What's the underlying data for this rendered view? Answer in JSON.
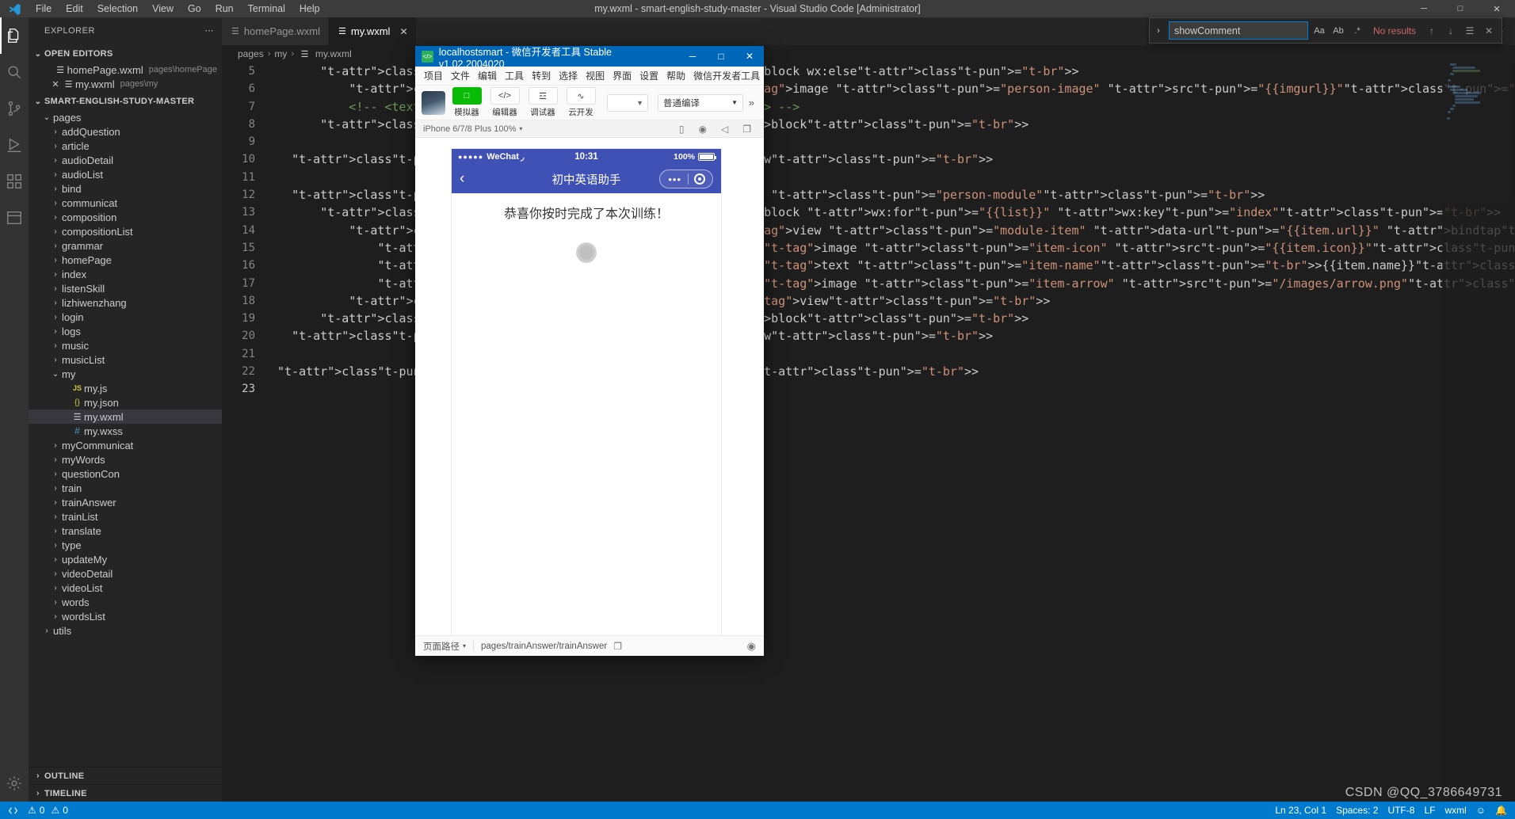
{
  "window": {
    "title": "my.wxml - smart-english-study-master - Visual Studio Code [Administrator]",
    "menus": [
      "File",
      "Edit",
      "Selection",
      "View",
      "Go",
      "Run",
      "Terminal",
      "Help"
    ],
    "controls": {
      "minimize": "─",
      "maximize": "□",
      "close": "✕"
    }
  },
  "activitybar": {
    "items": [
      {
        "name": "explorer",
        "glyph": "❐"
      },
      {
        "name": "search",
        "glyph": "⌕"
      },
      {
        "name": "source-control",
        "glyph": "⎇"
      },
      {
        "name": "run-debug",
        "glyph": "▷"
      },
      {
        "name": "extensions",
        "glyph": "▦"
      },
      {
        "name": "test",
        "glyph": "▤"
      }
    ],
    "settings_glyph": "⚙"
  },
  "sidebar": {
    "header": "EXPLORER",
    "header_more": "⋯",
    "open_editors": {
      "title": "OPEN EDITORS",
      "chevron": "⌄",
      "items": [
        {
          "name": "homePage.wxml",
          "path": "pages\\homePage",
          "icon": "wxml-icon",
          "closable": false
        },
        {
          "name": "my.wxml",
          "path": "pages\\my",
          "icon": "wxml-icon",
          "closable": true
        }
      ]
    },
    "project": {
      "title": "SMART-ENGLISH-STUDY-MASTER",
      "chevron": "⌄"
    },
    "tree": [
      {
        "label": "pages",
        "indent": 1,
        "type": "folder",
        "open": true
      },
      {
        "label": "addQuestion",
        "indent": 2,
        "type": "folder",
        "open": false
      },
      {
        "label": "article",
        "indent": 2,
        "type": "folder",
        "open": false
      },
      {
        "label": "audioDetail",
        "indent": 2,
        "type": "folder",
        "open": false
      },
      {
        "label": "audioList",
        "indent": 2,
        "type": "folder",
        "open": false
      },
      {
        "label": "bind",
        "indent": 2,
        "type": "folder",
        "open": false
      },
      {
        "label": "communicat",
        "indent": 2,
        "type": "folder",
        "open": false
      },
      {
        "label": "composition",
        "indent": 2,
        "type": "folder",
        "open": false
      },
      {
        "label": "compositionList",
        "indent": 2,
        "type": "folder",
        "open": false
      },
      {
        "label": "grammar",
        "indent": 2,
        "type": "folder",
        "open": false
      },
      {
        "label": "homePage",
        "indent": 2,
        "type": "folder",
        "open": false
      },
      {
        "label": "index",
        "indent": 2,
        "type": "folder",
        "open": false
      },
      {
        "label": "listenSkill",
        "indent": 2,
        "type": "folder",
        "open": false
      },
      {
        "label": "lizhiwenzhang",
        "indent": 2,
        "type": "folder",
        "open": false
      },
      {
        "label": "login",
        "indent": 2,
        "type": "folder",
        "open": false
      },
      {
        "label": "logs",
        "indent": 2,
        "type": "folder",
        "open": false
      },
      {
        "label": "music",
        "indent": 2,
        "type": "folder",
        "open": false
      },
      {
        "label": "musicList",
        "indent": 2,
        "type": "folder",
        "open": false
      },
      {
        "label": "my",
        "indent": 2,
        "type": "folder",
        "open": true
      },
      {
        "label": "my.js",
        "indent": 3,
        "type": "js"
      },
      {
        "label": "my.json",
        "indent": 3,
        "type": "json"
      },
      {
        "label": "my.wxml",
        "indent": 3,
        "type": "wxml",
        "selected": true
      },
      {
        "label": "my.wxss",
        "indent": 3,
        "type": "wxss"
      },
      {
        "label": "myCommunicat",
        "indent": 2,
        "type": "folder",
        "open": false
      },
      {
        "label": "myWords",
        "indent": 2,
        "type": "folder",
        "open": false
      },
      {
        "label": "questionCon",
        "indent": 2,
        "type": "folder",
        "open": false
      },
      {
        "label": "train",
        "indent": 2,
        "type": "folder",
        "open": false
      },
      {
        "label": "trainAnswer",
        "indent": 2,
        "type": "folder",
        "open": false
      },
      {
        "label": "trainList",
        "indent": 2,
        "type": "folder",
        "open": false
      },
      {
        "label": "translate",
        "indent": 2,
        "type": "folder",
        "open": false
      },
      {
        "label": "type",
        "indent": 2,
        "type": "folder",
        "open": false
      },
      {
        "label": "updateMy",
        "indent": 2,
        "type": "folder",
        "open": false
      },
      {
        "label": "videoDetail",
        "indent": 2,
        "type": "folder",
        "open": false
      },
      {
        "label": "videoList",
        "indent": 2,
        "type": "folder",
        "open": false
      },
      {
        "label": "words",
        "indent": 2,
        "type": "folder",
        "open": false
      },
      {
        "label": "wordsList",
        "indent": 2,
        "type": "folder",
        "open": false
      },
      {
        "label": "utils",
        "indent": 1,
        "type": "folder",
        "open": false
      }
    ],
    "footer_sections": [
      {
        "label": "OUTLINE",
        "chevron": "›"
      },
      {
        "label": "TIMELINE",
        "chevron": "›"
      }
    ]
  },
  "editor": {
    "tabs": [
      {
        "label": "homePage.wxml",
        "icon": "wxml-icon",
        "active": false,
        "closable": false
      },
      {
        "label": "my.wxml",
        "icon": "wxml-icon",
        "active": true,
        "closable": true,
        "close_glyph": "✕"
      }
    ],
    "tab_actions": [
      {
        "name": "split-editor-icon",
        "glyph": "◫"
      },
      {
        "name": "more-actions-icon",
        "glyph": "⋯"
      }
    ],
    "breadcrumbs": [
      "pages",
      "my",
      "my.wxml"
    ],
    "breadcrumb_sep": "›",
    "first_line_number": 5,
    "lines": [
      {
        "n": 5,
        "text": "      <block wx:else>"
      },
      {
        "n": 6,
        "text": "          <image class=\"person-image\" src=\"{{imgurl}}\"></image>"
      },
      {
        "n": 7,
        "text": "          <!-- <text class=\"person-name\">{{userInfo.nickName}}</text> -->"
      },
      {
        "n": 8,
        "text": "      </block>"
      },
      {
        "n": 9,
        "text": ""
      },
      {
        "n": 10,
        "text": "  </view>"
      },
      {
        "n": 11,
        "text": ""
      },
      {
        "n": 12,
        "text": "  <view class=\"person-module\">"
      },
      {
        "n": 13,
        "text": "      <block wx:for=\"{{list}}\" wx:key=\"index\">"
      },
      {
        "n": 14,
        "text": "          <view class=\"module-item\" data-url=\"{{item.url}}\" bindtap=\"jump\">"
      },
      {
        "n": 15,
        "text": "              <image class=\"item-icon\" src=\"{{item.icon}}\"></image>"
      },
      {
        "n": 16,
        "text": "              <text class=\"item-name\">{{item.name}}</text>"
      },
      {
        "n": 17,
        "text": "              <image class=\"item-arrow\" src=\"/images/arrow.png\"></image>"
      },
      {
        "n": 18,
        "text": "          </view>"
      },
      {
        "n": 19,
        "text": "      </block>"
      },
      {
        "n": 20,
        "text": "  </view>"
      },
      {
        "n": 21,
        "text": ""
      },
      {
        "n": 22,
        "text": "</view>"
      },
      {
        "n": 23,
        "text": ""
      }
    ],
    "find": {
      "toggle_glyph": "›",
      "query": "showComment",
      "placeholder": "Find",
      "options": [
        {
          "name": "match-case-icon",
          "glyph": "Aa"
        },
        {
          "name": "match-whole-word-icon",
          "glyph": "Ab"
        },
        {
          "name": "use-regex-icon",
          "glyph": ".*"
        }
      ],
      "results": "No results",
      "buttons": [
        {
          "name": "previous-match-icon",
          "glyph": "↑"
        },
        {
          "name": "next-match-icon",
          "glyph": "↓"
        },
        {
          "name": "find-in-selection-icon",
          "glyph": "☰"
        },
        {
          "name": "close-find-icon",
          "glyph": "✕"
        }
      ]
    }
  },
  "statusbar": {
    "left": [
      {
        "name": "remote-indicator",
        "glyph": "⌥",
        "label": ""
      },
      {
        "name": "problems",
        "glyph": "⊗ 0  ⚠ 0",
        "label": ""
      }
    ],
    "errors": "0",
    "warnings": "0",
    "right": [
      {
        "name": "cursor-position",
        "label": "Ln 23, Col 1"
      },
      {
        "name": "indentation",
        "label": "Spaces: 2"
      },
      {
        "name": "encoding",
        "label": "UTF-8"
      },
      {
        "name": "eol",
        "label": "LF"
      },
      {
        "name": "language-mode",
        "label": "wxml"
      },
      {
        "name": "feedback",
        "label": "☺"
      },
      {
        "name": "notifications",
        "label": "🔔"
      }
    ]
  },
  "wechat_devtools": {
    "title": "localhostsmart - 微信开发者工具 Stable v1.02.2004020",
    "logo_glyph": "</>",
    "controls": {
      "minimize": "─",
      "maximize": "□",
      "close": "✕"
    },
    "menus": [
      "项目",
      "文件",
      "编辑",
      "工具",
      "转到",
      "选择",
      "视图",
      "界面",
      "设置",
      "帮助",
      "微信开发者工具"
    ],
    "toolbar": {
      "avatar_name": "project-avatar",
      "items": [
        {
          "label": "模拟器",
          "glyph": "□",
          "active": true,
          "name": "simulator-toggle"
        },
        {
          "label": "编辑器",
          "glyph": "</>",
          "active": false,
          "name": "editor-toggle"
        },
        {
          "label": "调试器",
          "glyph": "☲",
          "active": false,
          "name": "debugger-toggle"
        },
        {
          "label": "云开发",
          "glyph": "∿",
          "active": false,
          "name": "cloud-dev-button"
        }
      ],
      "select_empty": "",
      "compile_mode": "普通编译",
      "chevron": "▾",
      "more_glyph": "»"
    },
    "device_bar": {
      "device": "iPhone 6/7/8 Plus 100%",
      "chevron": "▾",
      "right_icons": [
        {
          "name": "rotate-device-icon",
          "glyph": "▯"
        },
        {
          "name": "record-icon",
          "glyph": "◉"
        },
        {
          "name": "sound-icon",
          "glyph": "◁"
        },
        {
          "name": "screenshot-icon",
          "glyph": "❐"
        }
      ]
    },
    "simulator": {
      "status_bar": {
        "signal_dots": "●●●●●",
        "carrier": "WeChat",
        "wifi_glyph": "◞",
        "time": "10:31",
        "battery": "100%"
      },
      "nav": {
        "back_glyph": "‹",
        "title": "初中英语助手",
        "capsule_dots": "•••"
      },
      "content": {
        "message": "恭喜你按时完成了本次训练！"
      }
    },
    "footer": {
      "label": "页面路径",
      "chevron": "▾",
      "path": "pages/trainAnswer/trainAnswer",
      "copy_glyph": "❐",
      "eye_glyph": "◉"
    }
  },
  "watermark": "CSDN @QQ_3786649731",
  "colors": {
    "vscode_titlebar": "#3c3c3c",
    "vscode_sidebar": "#252526",
    "vscode_editor": "#1e1e1e",
    "statusbar_blue": "#007acc",
    "wechat_titlebar": "#0067b8",
    "wechat_green": "#09bb07",
    "simulator_nav": "#3f51b5"
  }
}
